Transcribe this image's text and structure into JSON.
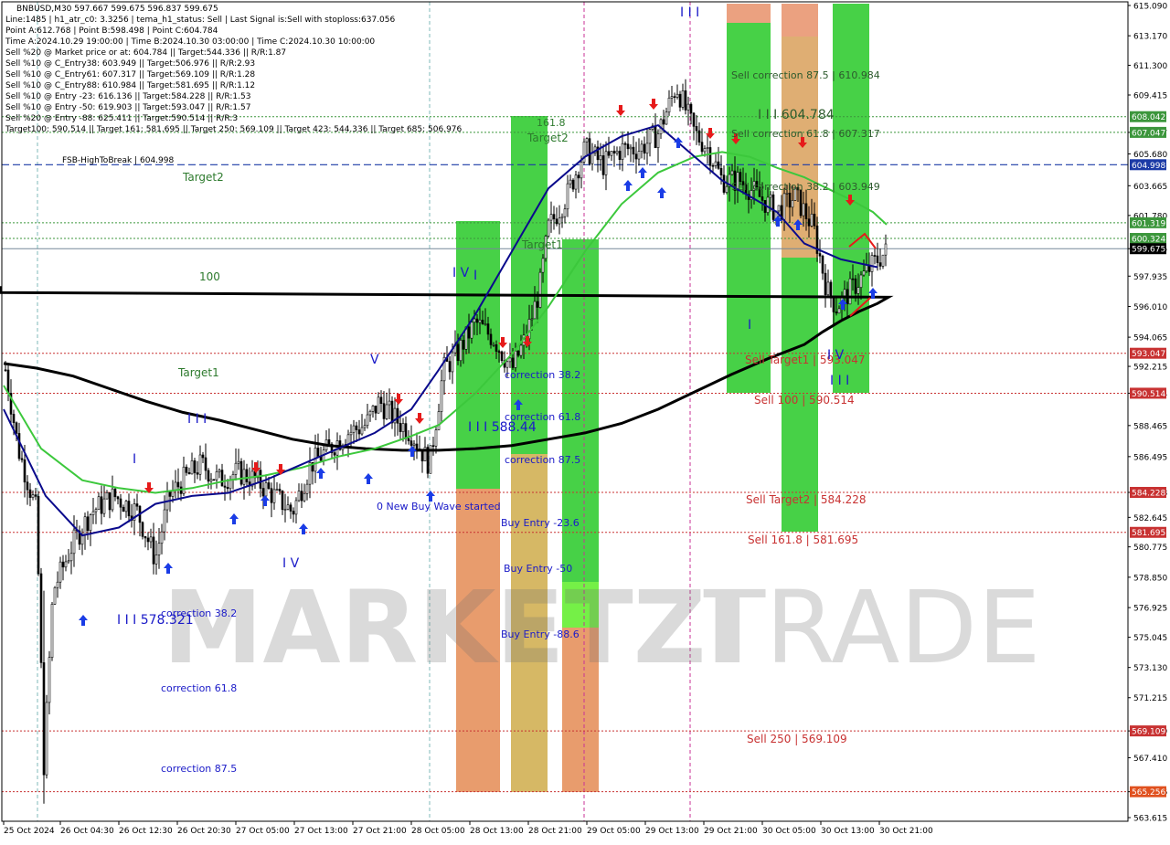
{
  "window": {
    "title": "BNBUSD,M30  597.667 599.675 596.837 599.675"
  },
  "info_lines": [
    "Line:1485  |  h1_atr_c0: 3.3256  |  tema_h1_status: Sell  |  Last Signal is:Sell with stoploss:637.056",
    "Point A:612.768  |  Point B:598.498  |  Point C:604.784",
    "Time A:2024.10.29 19:00:00  |  Time B:2024.10.30 03:00:00  |  Time C:2024.10.30 10:00:00",
    "Sell %20 @ Market price or at: 604.784  ||  Target:544.336  ||  R/R:1.87",
    "Sell %10 @ C_Entry38: 603.949  ||  Target:506.976  ||  R/R:2.93",
    "Sell %10 @ C_Entry61: 607.317  ||  Target:569.109  ||  R/R:1.28",
    "Sell %10 @ C_Entry88: 610.984  ||  Target:581.695  ||  R/R:1.12",
    "Sell %10 @ Entry -23: 616.136  ||  Target:584.228  ||  R/R:1.53",
    "Sell %10 @ Entry -50: 619.903  ||  Target:593.047  ||  R/R:1.57",
    "Sell %20 @ Entry -88: 625.411  ||  Target:590.514  ||  R/R:3",
    "Target100: 590.514  ||  Target 161: 581.695  ||  Target 250: 569.109  ||  Target 423: 544.336  ||  Target 685: 506.976"
  ],
  "watermark": {
    "left": "MARKETZI",
    "right": "TRADE"
  },
  "chart_data": {
    "type": "candlestick",
    "symbol": "BNBUSD",
    "timeframe": "M30",
    "ylim": [
      563.615,
      615.09
    ],
    "x_ticks": [
      "25 Oct 2024",
      "26 Oct 04:30",
      "26 Oct 12:30",
      "26 Oct 20:30",
      "27 Oct 05:00",
      "27 Oct 13:00",
      "27 Oct 21:00",
      "28 Oct 05:00",
      "28 Oct 13:00",
      "28 Oct 21:00",
      "29 Oct 05:00",
      "29 Oct 13:00",
      "29 Oct 21:00",
      "30 Oct 05:00",
      "30 Oct 13:00",
      "30 Oct 21:00"
    ],
    "y_ticks": [
      "615.090",
      "613.170",
      "611.300",
      "609.415",
      "607.047",
      "605.680",
      "603.665",
      "601.780",
      "599.675",
      "597.935",
      "596.010",
      "594.065",
      "592.215",
      "590.514",
      "588.465",
      "586.495",
      "584.228",
      "582.645",
      "580.775",
      "578.850",
      "576.925",
      "575.045",
      "573.130",
      "571.215",
      "569.109",
      "567.410",
      "565.256",
      "563.615"
    ],
    "price_labels": [
      {
        "text": "608.042",
        "value": 608.042,
        "color": "#3c963c"
      },
      {
        "text": "607.047",
        "value": 607.047,
        "color": "#3c963c"
      },
      {
        "text": "604.998",
        "value": 604.998,
        "color": "#1b3aa6"
      },
      {
        "text": "601.319",
        "value": 601.319,
        "color": "#3c963c"
      },
      {
        "text": "600.324",
        "value": 600.324,
        "color": "#3c963c"
      },
      {
        "text": "599.675",
        "value": 599.675,
        "color": "#000000"
      },
      {
        "text": "593.047",
        "value": 593.047,
        "color": "#c83232"
      },
      {
        "text": "590.514",
        "value": 590.514,
        "color": "#c83232"
      },
      {
        "text": "584.228",
        "value": 584.228,
        "color": "#c83232"
      },
      {
        "text": "581.695",
        "value": 581.695,
        "color": "#c83232"
      },
      {
        "text": "569.109",
        "value": 569.109,
        "color": "#c83232"
      },
      {
        "text": "565.256",
        "value": 565.256,
        "color": "#e0501e"
      }
    ],
    "levels": [
      {
        "value": 608.042,
        "color": "#3c963c",
        "style": "dotted"
      },
      {
        "value": 607.047,
        "color": "#3c963c",
        "style": "dotted"
      },
      {
        "value": 604.998,
        "color": "#1b3aa6",
        "style": "dashed"
      },
      {
        "value": 601.319,
        "color": "#3c963c",
        "style": "dotted"
      },
      {
        "value": 600.324,
        "color": "#3c963c",
        "style": "dotted"
      },
      {
        "value": 599.675,
        "color": "#778899",
        "style": "solid"
      },
      {
        "value": 593.047,
        "color": "#c83232",
        "style": "dotted"
      },
      {
        "value": 590.514,
        "color": "#c83232",
        "style": "dotted"
      },
      {
        "value": 584.228,
        "color": "#c83232",
        "style": "dotted"
      },
      {
        "value": 581.695,
        "color": "#c83232",
        "style": "dotted"
      },
      {
        "value": 569.109,
        "color": "#c83232",
        "style": "dotted"
      },
      {
        "value": 565.256,
        "color": "#c83232",
        "style": "dotted"
      }
    ],
    "annotations": [
      {
        "text": "FSB-HighToBreak  |  604.998",
        "color": "#000000"
      },
      {
        "text": "Target2",
        "color": "#2d7a2d"
      },
      {
        "text": "100",
        "color": "#2d7a2d"
      },
      {
        "text": "Target1",
        "color": "#2d7a2d"
      },
      {
        "text": "161.8",
        "color": "#2d7a2d"
      },
      {
        "text": "Target2",
        "color": "#2d7a2d"
      },
      {
        "text": "Target1",
        "color": "#2d7a2d"
      },
      {
        "text": "Sell correction 87.5  |  610.984",
        "color": "#2d5a2d"
      },
      {
        "text": "I I I  604.784",
        "color": "#2d5a2d"
      },
      {
        "text": "Sell correction 61.8  |  607.317",
        "color": "#2d5a2d"
      },
      {
        "text": "Sell correction 38.2  |  603.949",
        "color": "#2d5a2d"
      },
      {
        "text": "Sell Target1  |  593.047",
        "color": "#c83232"
      },
      {
        "text": "Sell 100  |  590.514",
        "color": "#c83232"
      },
      {
        "text": "Sell Target2  |  584.228",
        "color": "#c83232"
      },
      {
        "text": "Sell 161.8  |  581.695",
        "color": "#c83232"
      },
      {
        "text": "Sell  250  |  569.109",
        "color": "#c83232"
      },
      {
        "text": "correction 38.2",
        "color": "#1a1ac8"
      },
      {
        "text": "correction 61.8",
        "color": "#1a1ac8"
      },
      {
        "text": "correction 87.5",
        "color": "#1a1ac8"
      },
      {
        "text": "I I I  588.44",
        "color": "#1a1ac8"
      },
      {
        "text": "0 New Buy Wave started",
        "color": "#1a1ac8"
      },
      {
        "text": "Buy Entry -23.6",
        "color": "#1a1ac8"
      },
      {
        "text": "Buy Entry -50",
        "color": "#1a1ac8"
      },
      {
        "text": "Buy Entry -88.6",
        "color": "#1a1ac8"
      },
      {
        "text": "correction 38.2",
        "color": "#1a1ac8"
      },
      {
        "text": "I I I  578.321",
        "color": "#1a1ac8"
      },
      {
        "text": "correction 61.8",
        "color": "#1a1ac8"
      },
      {
        "text": "correction 87.5",
        "color": "#1a1ac8"
      },
      {
        "text": "I",
        "color": "#1a1ac8"
      },
      {
        "text": "I I I",
        "color": "#1a1ac8"
      },
      {
        "text": "V",
        "color": "#1a1ac8"
      },
      {
        "text": "I V",
        "color": "#1a1ac8"
      },
      {
        "text": "I V",
        "color": "#1a1ac8"
      },
      {
        "text": "I",
        "color": "#1a1ac8"
      },
      {
        "text": "I I I",
        "color": "#1a1ac8"
      },
      {
        "text": "I",
        "color": "#1a1ac8"
      },
      {
        "text": "I V",
        "color": "#1a1ac8"
      },
      {
        "text": "I I I",
        "color": "#1a1ac8"
      }
    ],
    "series": [
      {
        "name": "",
        "color": "#000000",
        "values": [
          592.4,
          592.1,
          591.6,
          590.8,
          590.0,
          589.3,
          588.8,
          588.2,
          587.6,
          587.2,
          587.0,
          586.9,
          586.9,
          587.0,
          587.2,
          587.6,
          588.0,
          588.6,
          589.5,
          590.6,
          591.7,
          592.7,
          593.6,
          594.4,
          595.1,
          595.7,
          596.2,
          596.6,
          596.9,
          597.1,
          597.2,
          597.3
        ]
      },
      {
        "name": "",
        "color": "#3cc83c",
        "values": [
          591.0,
          587.0,
          585.0,
          584.5,
          584.2,
          584.5,
          585.0,
          585.3,
          585.8,
          586.5,
          587.0,
          587.8,
          588.5,
          590.5,
          593.0,
          596.0,
          599.5,
          602.5,
          604.5,
          605.5,
          605.8,
          605.5,
          604.8,
          604.2,
          603.5,
          602.8,
          602.0,
          601.2
        ]
      },
      {
        "name": "",
        "color": "#0a0a8c",
        "values": [
          589.5,
          584.0,
          581.5,
          582.0,
          583.5,
          584.0,
          584.2,
          585.0,
          586.0,
          587.0,
          588.0,
          589.5,
          592.0,
          595.5,
          599.5,
          603.5,
          605.5,
          606.8,
          607.5,
          605.5,
          604.0,
          603.0,
          602.0,
          600.0,
          599.0,
          598.5
        ]
      }
    ]
  }
}
